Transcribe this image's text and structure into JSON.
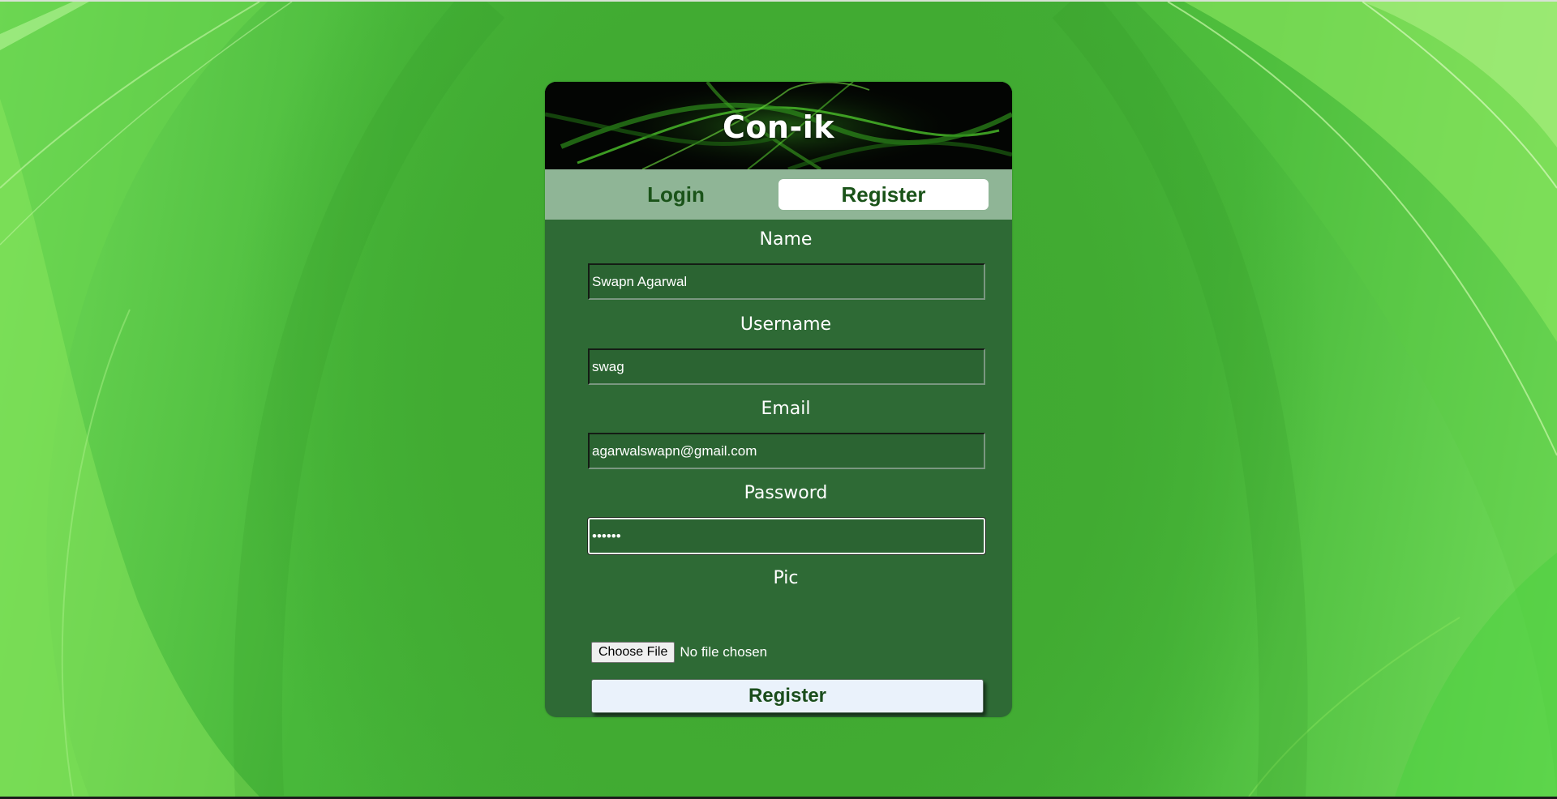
{
  "app": {
    "brand": "Con-ik"
  },
  "tabs": [
    {
      "label": "Login",
      "active": false
    },
    {
      "label": "Register",
      "active": true
    }
  ],
  "form": {
    "name": {
      "label": "Name",
      "value": "Swapn Agarwal"
    },
    "username": {
      "label": "Username",
      "value": "swag"
    },
    "email": {
      "label": "Email",
      "value": "agarwalswapn@gmail.com"
    },
    "password": {
      "label": "Password",
      "value": "swag12"
    },
    "pic": {
      "label": "Pic",
      "button": "Choose File",
      "status": "No file chosen"
    },
    "submit_label": "Register"
  },
  "colors": {
    "background": "#43b62f",
    "card": "#2e6a35",
    "tab_bar": "#8fb596",
    "tab_text": "#1a5319",
    "submit_bg": "#eaf2fb"
  }
}
